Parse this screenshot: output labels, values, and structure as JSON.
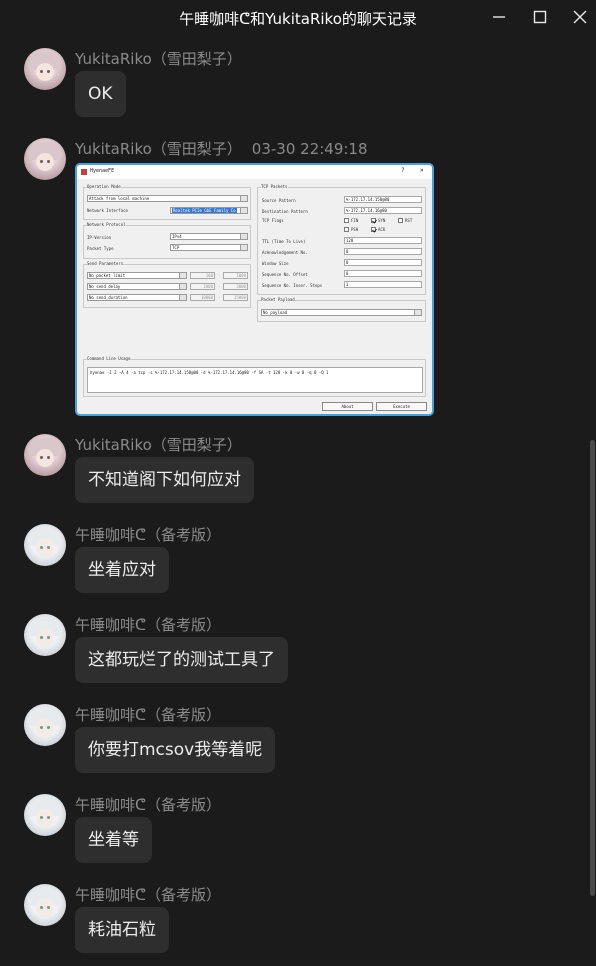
{
  "window": {
    "title": "午睡咖啡ᕦ和YukitaRiko的聊天记录"
  },
  "messages": [
    {
      "sender": "YukitaRiko（雪田梨子）",
      "text": "OK"
    },
    {
      "sender": "YukitaRiko（雪田梨子）",
      "time": "03-30 22:49:18"
    },
    {
      "sender": "YukitaRiko（雪田梨子）",
      "text": "不知道阁下如何应对"
    },
    {
      "sender": "午睡咖啡ᕦ（备考版）",
      "text": "坐着应对"
    },
    {
      "sender": "午睡咖啡ᕦ（备考版）",
      "text": "这都玩烂了的测试工具了"
    },
    {
      "sender": "午睡咖啡ᕦ（备考版）",
      "text": "你要打mcsov我等着呢"
    },
    {
      "sender": "午睡咖啡ᕦ（备考版）",
      "text": "坐着等"
    },
    {
      "sender": "午睡咖啡ᕦ（备考版）",
      "text": "耗油石粒"
    }
  ],
  "screenshot": {
    "title": "HyenaeFE",
    "help": "?",
    "close": "×",
    "operation_mode_label": "Operation Mode",
    "operation_mode_value": "Attack from local machine",
    "network_interface_label": "Network Interface",
    "network_interface_value": "Realtek PCIe GbE Family Co",
    "network_protocol_label": "Network Protocol",
    "ip_version_label": "IP-Version",
    "ip_version_value": "IPv4",
    "packet_type_label": "Packet Type",
    "packet_type_value": "TCP",
    "send_parameters_label": "Send Parameters",
    "packet_limit_value": "No packet limit",
    "packet_limit_num": "100",
    "send_delay_value": "No send delay",
    "send_delay_a": "1000",
    "send_delay_b": "3000",
    "send_duration_value": "No send duration",
    "send_duration_a": "10000",
    "send_duration_b": "15000",
    "range_sep_1": "-",
    "range_sep_2": "-",
    "range_sep_3": "-",
    "limit_right": "1000",
    "tcp_packets_label": "TCP Packets",
    "source_pattern_label": "Source Pattern",
    "source_pattern_value": "%-172.17.14.158@80",
    "dest_pattern_label": "Destination Pattern",
    "dest_pattern_value": "%-172.17.14.16@80",
    "tcp_flags_label": "TCP Flags",
    "flag_fin": "FIN",
    "flag_syn": "SYN",
    "flag_rst": "RST",
    "flag_psh": "PSH",
    "flag_ack": "ACK",
    "ttl_label": "TTL (Time To Live)",
    "ttl_value": "128",
    "ack_label": "Acknowledgement No.",
    "ack_value": "0",
    "window_label": "Window Size",
    "window_value": "0",
    "seq_offset_label": "Sequence No. Offset",
    "seq_offset_value": "0",
    "seq_steps_label": "Sequence No. Inser. Steps",
    "seq_steps_value": "1",
    "payload_label": "Packet Payload",
    "payload_value": "No payload",
    "cmd_label": "Command Line Usage",
    "cmd_value": "hyenae -I 2 -A 4 -a tcp -s %-172.17.14.158@80 -d %-172.17.14.16@80 -f SA -t 128 -k 0 -w 0 -q 0 -Q 1",
    "about_button": "About",
    "execute_button": "Execute"
  }
}
